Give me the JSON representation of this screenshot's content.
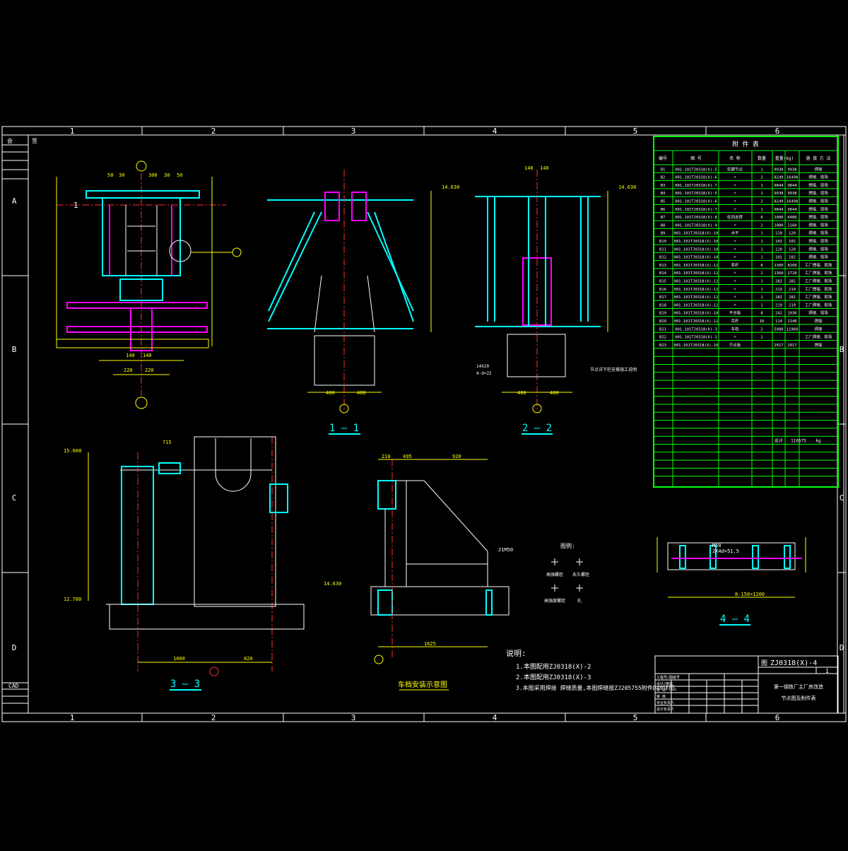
{
  "grid": {
    "columns": [
      "1",
      "2",
      "3",
      "4",
      "5",
      "6"
    ],
    "rows": [
      "A",
      "B",
      "C",
      "D"
    ]
  },
  "left_column": {
    "top_label": "会",
    "mid_label": "签",
    "bottom_label": "CAD"
  },
  "views": {
    "detail_top_left": {
      "dims": [
        "50",
        "30",
        "300",
        "30",
        "50",
        "190",
        "60X10=780",
        "100",
        "715",
        "225",
        "295",
        "100",
        "140",
        "140",
        "220",
        "220",
        "1190",
        "1000",
        "800"
      ],
      "callout": "1"
    },
    "section_1_1": {
      "title": "1 — 1",
      "elev": "14.630",
      "dims": [
        "50",
        "50",
        "1950",
        "220",
        "400",
        "400",
        "30",
        "93"
      ]
    },
    "section_2_2": {
      "title": "2 — 2",
      "elev": "14.630",
      "dims": [
        "140",
        "140",
        "2000",
        "980",
        "75",
        "75",
        "400",
        "400",
        "6-150=900",
        "30",
        "30"
      ],
      "note": "节点详下柱支撑施工说明",
      "plate": "14X20",
      "plate2": "4-d=22"
    },
    "section_3_3": {
      "title": "3 — 3",
      "elev_top": "15.000",
      "elev_bot": "12.780",
      "dims": [
        "715",
        "170",
        "2000",
        "50",
        "1000",
        "820",
        "20"
      ]
    },
    "crane_stop": {
      "title": "车档安装示意图",
      "elev": "14.630",
      "dims": [
        "210",
        "495",
        "920",
        "300",
        "1370",
        "40",
        "210",
        "370",
        "210",
        "358",
        "1057",
        "1625",
        "21M50"
      ]
    },
    "section_4_4": {
      "title": "4 — 4",
      "dims": [
        "M50",
        "2X4d=51.5",
        "10",
        "210",
        "200",
        "8-150=1200",
        "65",
        "40",
        "200"
      ]
    },
    "legend": {
      "title": "图例:",
      "items": [
        "高强螺栓",
        "永久螺栓",
        "高强度螺栓",
        "孔"
      ]
    },
    "notes": {
      "title": "说明:",
      "items": [
        "1.本图配用ZJ0318(X)-2",
        "2.本图配用ZJ0318(X)-3",
        "3.本图采用焊接   焊缝质量,本图焊缝按ZJ205755附件D49详图。"
      ]
    }
  },
  "parts_table": {
    "title": "附  件  表",
    "headers": [
      "编号",
      "图  号",
      "名  称",
      "数量",
      "重量(kg)",
      "施 接 方 法"
    ],
    "subheaders": [
      "单重",
      "总重"
    ],
    "rows": [
      [
        "B1",
        "001.101TJ0318(X)-5",
        "柱脚节点",
        "1",
        "9938",
        "9938",
        "焊接"
      ],
      [
        "B2",
        "001.101TJ0318(X)-6",
        "〃",
        "2",
        "8249",
        "16498",
        "焊接、现场"
      ],
      [
        "B3",
        "001.101TJ0318(X)-7",
        "〃",
        "1",
        "9844",
        "9844",
        "焊接、现场"
      ],
      [
        "B4",
        "001.101TJ0318(X)-5",
        "〃",
        "1",
        "9938",
        "9938",
        "焊接、现场"
      ],
      [
        "B5",
        "001.101TJ0318(X)-6",
        "〃",
        "2",
        "8249",
        "16498",
        "焊接、现场"
      ],
      [
        "B6",
        "001.101TJ0318(X)-7",
        "〃",
        "1",
        "9844",
        "9844",
        "焊接、现场"
      ],
      [
        "B7",
        "001.101TJ0318(X)-8",
        "柱间支撑",
        "6",
        "1080",
        "6480",
        "焊接、现场"
      ],
      [
        "B8",
        "001.101TJ0318(X)-9",
        "〃",
        "2",
        "1080",
        "2160",
        "焊接、现场"
      ],
      [
        "B9",
        "001.101TJ0318(X)-10",
        "水平",
        "1",
        "120",
        "120",
        "焊接、现场"
      ],
      [
        "B10",
        "001.101TJ0318(X)-10",
        "〃",
        "1",
        "102",
        "102",
        "焊接、现场"
      ],
      [
        "B11",
        "001.101TJ0318(X)-10",
        "〃",
        "1",
        "120",
        "120",
        "焊接、现场"
      ],
      [
        "B12",
        "001.101TJ0318(X)-10",
        "〃",
        "1",
        "102",
        "102",
        "焊接、现场"
      ],
      [
        "B13",
        "001.101TJ0318(X)-11",
        "系杆",
        "6",
        "1360",
        "8160",
        "工厂焊接、现场"
      ],
      [
        "B14",
        "001.101TJ0318(X)-11",
        "〃",
        "2",
        "1360",
        "2720",
        "工厂焊接、现场"
      ],
      [
        "B15",
        "001.101TJ0318(X)-11",
        "〃",
        "1",
        "282",
        "282",
        "工厂焊接、现场"
      ],
      [
        "B16",
        "001.101TJ0318(X)-11",
        "〃",
        "1",
        "219",
        "219",
        "工厂焊接、现场"
      ],
      [
        "B17",
        "001.101TJ0318(X)-11",
        "〃",
        "1",
        "282",
        "282",
        "工厂焊接、现场"
      ],
      [
        "B18",
        "001.101TJ0318(X)-11",
        "〃",
        "1",
        "219",
        "219",
        "工厂焊接、现场"
      ],
      [
        "B19",
        "001.101TJ0318(X)-10",
        "平台板",
        "8",
        "242",
        "1936",
        "焊接、现场"
      ],
      [
        "B20",
        "001.101TJ0318(X)-11",
        "吊杆",
        "10",
        "114",
        "1140",
        "焊接"
      ],
      [
        "B21",
        "001.101TJ0318(X)-3",
        "车档",
        "2",
        "5980",
        "11960",
        "焊接"
      ],
      [
        "B22",
        "001.101TJ0318(X)-3",
        "〃",
        "2",
        "",
        "",
        "工厂焊接、现场"
      ],
      [
        "B23",
        "001.101TJ0318(X)-10",
        "节点板",
        "",
        "2017",
        "2017",
        "焊接"
      ]
    ],
    "total_label": "总计",
    "total_value": "110575",
    "total_unit": "kg"
  },
  "title_block": {
    "drawing_no_label": "图",
    "drawing_no": "ZJ0318(X)-4",
    "sheet": "1",
    "project": "第一钢铁厂主厂房改造",
    "title": "节点图及附件表",
    "row_labels": [
      "工程号/图纸号",
      "设计/审核",
      "校 对",
      "审 核",
      "专业负责人",
      "设计负责人"
    ]
  }
}
